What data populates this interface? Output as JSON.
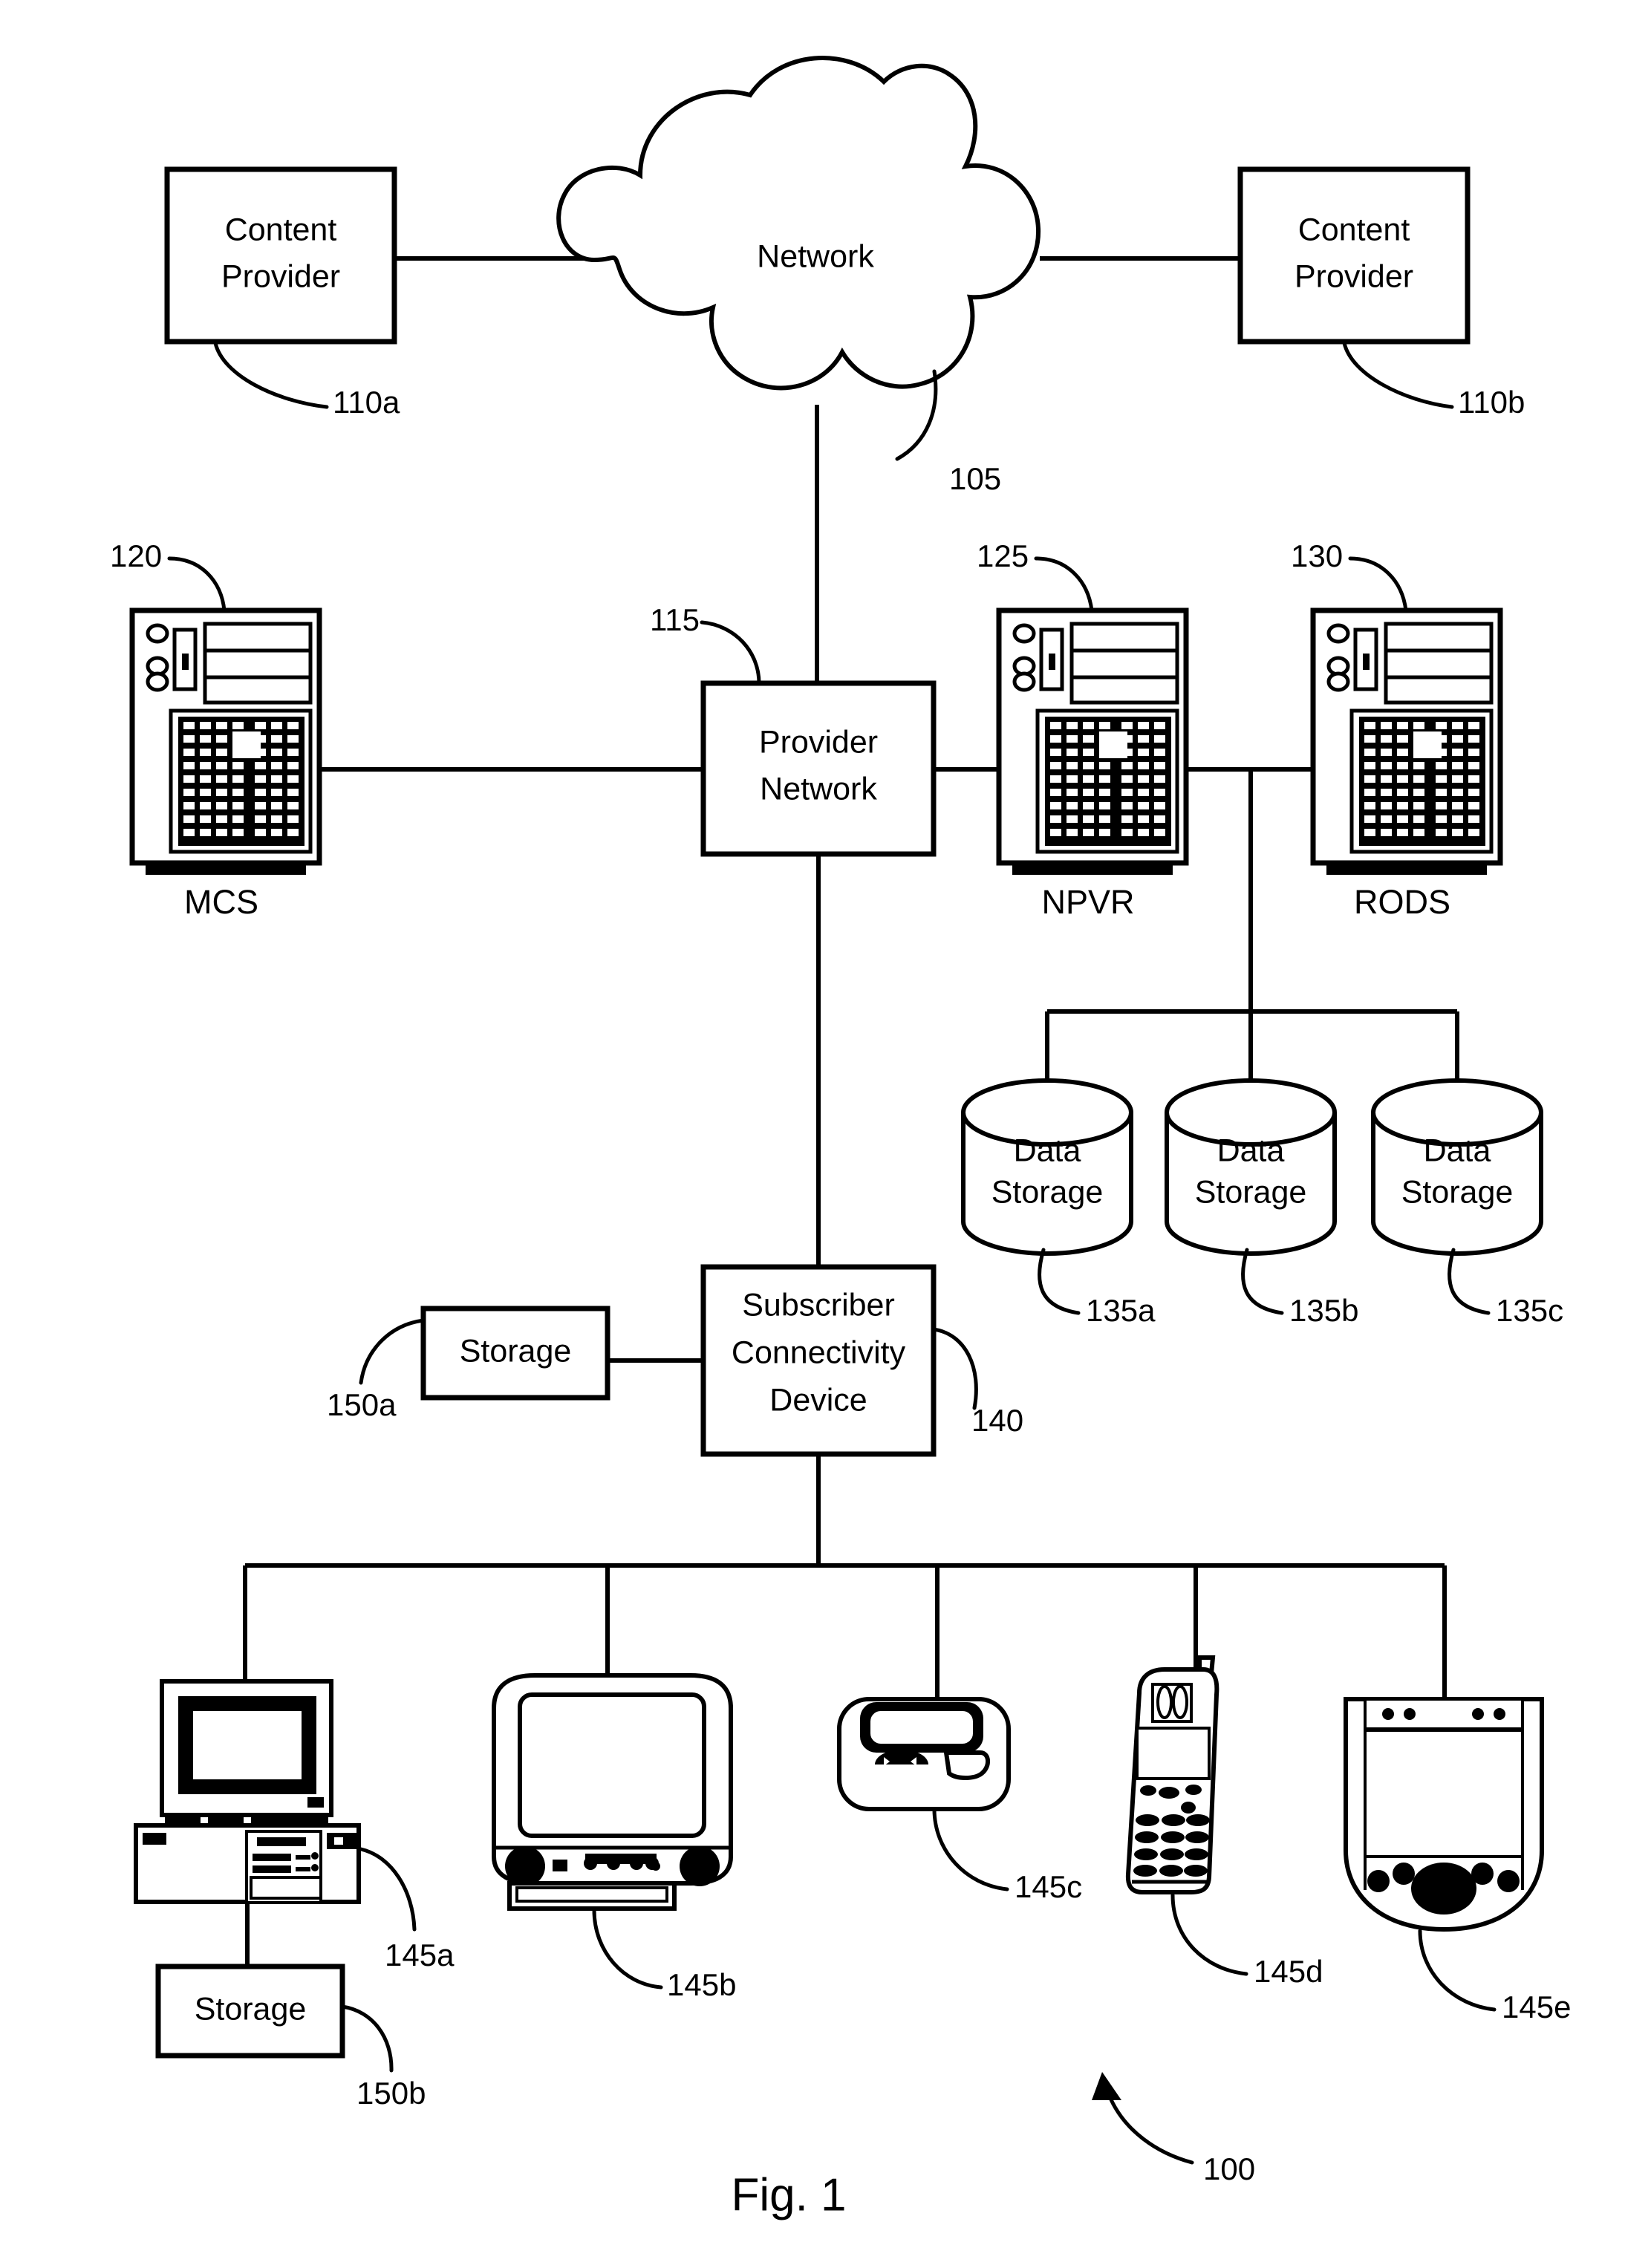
{
  "figure": {
    "caption": "Fig. 1",
    "system_ref": "100"
  },
  "nodes": {
    "content_provider_left": {
      "label_line1": "Content",
      "label_line2": "Provider",
      "ref": "110a"
    },
    "content_provider_right": {
      "label_line1": "Content",
      "label_line2": "Provider",
      "ref": "110b"
    },
    "network_cloud": {
      "label": "Network",
      "ref": "105"
    },
    "provider_network": {
      "label_line1": "Provider",
      "label_line2": "Network",
      "ref": "115"
    },
    "mcs_server": {
      "caption": "MCS",
      "ref": "120"
    },
    "npvr_server": {
      "caption": "NPVR",
      "ref": "125"
    },
    "rods_server": {
      "caption": "RODS",
      "ref": "130"
    },
    "data_storage_a": {
      "label_line1": "Data",
      "label_line2": "Storage",
      "ref": "135a"
    },
    "data_storage_b": {
      "label_line1": "Data",
      "label_line2": "Storage",
      "ref": "135b"
    },
    "data_storage_c": {
      "label_line1": "Data",
      "label_line2": "Storage",
      "ref": "135c"
    },
    "subscriber_connectivity_device": {
      "label_line1": "Subscriber",
      "label_line2": "Connectivity",
      "label_line3": "Device",
      "ref": "140"
    },
    "storage_upper": {
      "label": "Storage",
      "ref": "150a"
    },
    "storage_lower": {
      "label": "Storage",
      "ref": "150b"
    },
    "desktop_computer": {
      "ref": "145a"
    },
    "television": {
      "ref": "145b"
    },
    "pager": {
      "ref": "145c"
    },
    "cell_phone": {
      "ref": "145d"
    },
    "pda": {
      "ref": "145e"
    }
  },
  "colors": {
    "ink": "#000000",
    "paper": "#ffffff"
  }
}
